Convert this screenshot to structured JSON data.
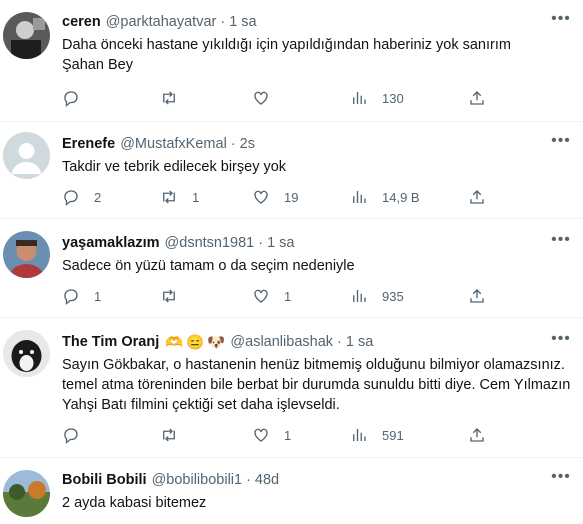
{
  "tweets": [
    {
      "name": "ceren",
      "handle": "@parktahayatvar",
      "time": "1 sa",
      "emoji": [],
      "text": "Daha önceki hastane yıkıldığı için yapıldığından haberiniz yok sanırım\nŞahan Bey",
      "replies": "",
      "retweets": "",
      "likes": "",
      "views": "130",
      "avatar_color": "#3a3a3a"
    },
    {
      "name": "Erenefe",
      "handle": "@MustafxKemal",
      "time": "2s",
      "emoji": [],
      "text": "Takdir ve tebrik edilecek birşey yok",
      "replies": "2",
      "retweets": "1",
      "likes": "19",
      "views": "14,9 B",
      "avatar_color": "#cfd9de"
    },
    {
      "name": "yaşamaklazım",
      "handle": "@dsntsn1981",
      "time": "1 sa",
      "emoji": [],
      "text": "Sadece ön yüzü tamam o da seçim nedeniyle",
      "replies": "1",
      "retweets": "",
      "likes": "1",
      "views": "935",
      "avatar_color": "#8a5a4a"
    },
    {
      "name": "The Tim Oranj",
      "handle": "@aslanlibashak",
      "time": "1 sa",
      "emoji": [
        "🫶",
        "😑",
        "🐶"
      ],
      "text": "Sayın Gökbakar, o hastanenin henüz bitmemiş olduğunu bilmiyor olamazsınız. temel atma töreninden bile berbat bir durumda sunuldu bitti diye. Cem Yılmazın Yahşi Batı filmini çektiği set daha işlevseldi.",
      "replies": "",
      "retweets": "",
      "likes": "1",
      "views": "591",
      "avatar_color": "#222222"
    },
    {
      "name": "Bobili Bobili",
      "handle": "@bobilibobili1",
      "time": "48d",
      "emoji": [],
      "text": "2 ayda kabasi bitemez",
      "avatar_color": "#5b7a3a"
    }
  ],
  "icons": {
    "more": "more-icon",
    "reply": "reply-icon",
    "retweet": "retweet-icon",
    "like": "heart-icon",
    "views": "views-icon",
    "share": "share-icon"
  }
}
